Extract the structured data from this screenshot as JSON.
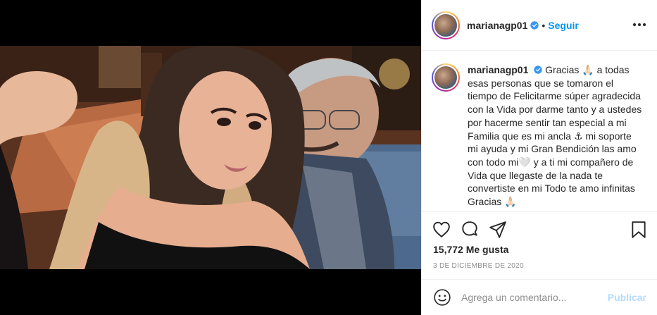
{
  "post": {
    "image_alt": "selfie"
  },
  "header": {
    "username": "marianagp01",
    "verified": true,
    "separator": "•",
    "follow_label": "Seguir",
    "more_icon": "more-dots-icon"
  },
  "caption": {
    "username": "marianagp01",
    "text": "Gracias 🙏🏻 a todas esas personas que se tomaron el tiempo de Felicitarme súper agradecida con la Vida por darme tanto y a ustedes por hacerme sentir tan especial a mi Familia que es mi ancla ⚓ mi soporte mi ayuda y mi Gran Bendición las amo con todo mi🤍 y a ti mi compañero de Vida que llegaste de la nada te convertiste en mi Todo te amo infinitas Gracias 🙏🏻"
  },
  "actions": {
    "like_icon": "heart-icon",
    "comment_icon": "comment-icon",
    "share_icon": "share-icon",
    "save_icon": "bookmark-icon"
  },
  "stats": {
    "likes": "15,772 Me gusta",
    "date": "3 de diciembre de 2020"
  },
  "comment": {
    "emoji_icon": "smiley-icon",
    "placeholder": "Agrega un comentario...",
    "publish_label": "Publicar"
  },
  "colors": {
    "accent": "#0095f6",
    "publish_disabled": "#b3dbff",
    "verified": "#3897f0",
    "muted": "#8e8e8e"
  }
}
